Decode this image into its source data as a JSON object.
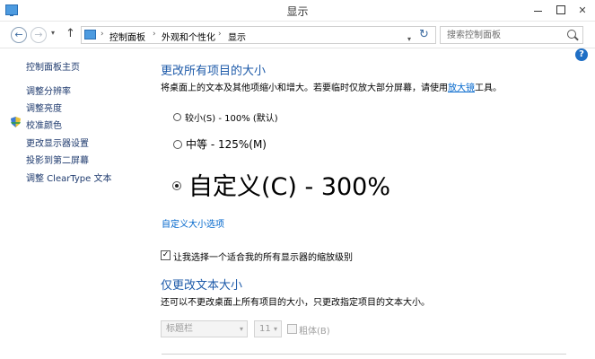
{
  "window": {
    "title": "显示",
    "minimize": "",
    "maximize": "",
    "close": ""
  },
  "nav": {
    "back": "←",
    "forward": "→",
    "recent": "▾",
    "up": "↑",
    "breadcrumbs": [
      "控制面板",
      "外观和个性化",
      "显示"
    ],
    "separator": "›",
    "address_dropdown": "▾",
    "refresh": "↻"
  },
  "search": {
    "placeholder": "搜索控制面板"
  },
  "help": "?",
  "sidebar": {
    "items": [
      {
        "label": "控制面板主页"
      },
      {
        "label": "调整分辨率"
      },
      {
        "label": "调整亮度"
      },
      {
        "label": "校准颜色"
      },
      {
        "label": "更改显示器设置"
      },
      {
        "label": "投影到第二屏幕"
      },
      {
        "label": "调整 ClearType 文本"
      }
    ]
  },
  "main": {
    "size_heading": "更改所有项目的大小",
    "size_desc_prefix": "将桌面上的文本及其他项缩小和增大。若要临时仅放大部分屏幕，请使用",
    "size_desc_link": "放大镜",
    "size_desc_suffix": "工具。",
    "options": [
      {
        "label": "较小(S) - 100% (默认)",
        "selected": false
      },
      {
        "label": "中等 - 125%(M)",
        "selected": false
      },
      {
        "label": "自定义(C) - 300%",
        "selected": true
      }
    ],
    "custom_size_link": "自定义大小选项",
    "scaling_checkbox": {
      "label": "让我选择一个适合我的所有显示器的缩放级别",
      "checked": true
    },
    "text_heading": "仅更改文本大小",
    "text_desc": "还可以不更改桌面上所有项目的大小，只更改指定项目的文本大小。",
    "item_select": {
      "value": "标题栏"
    },
    "size_select": {
      "value": "11"
    },
    "bold_checkbox": {
      "label": "粗体(B)",
      "checked": false
    },
    "dropdown_chevron": "▾",
    "check_mark": "✓"
  },
  "colors": {
    "heading": "#1d5aa9",
    "link": "#0066cc",
    "sidebar_link": "#1e3a6e"
  }
}
